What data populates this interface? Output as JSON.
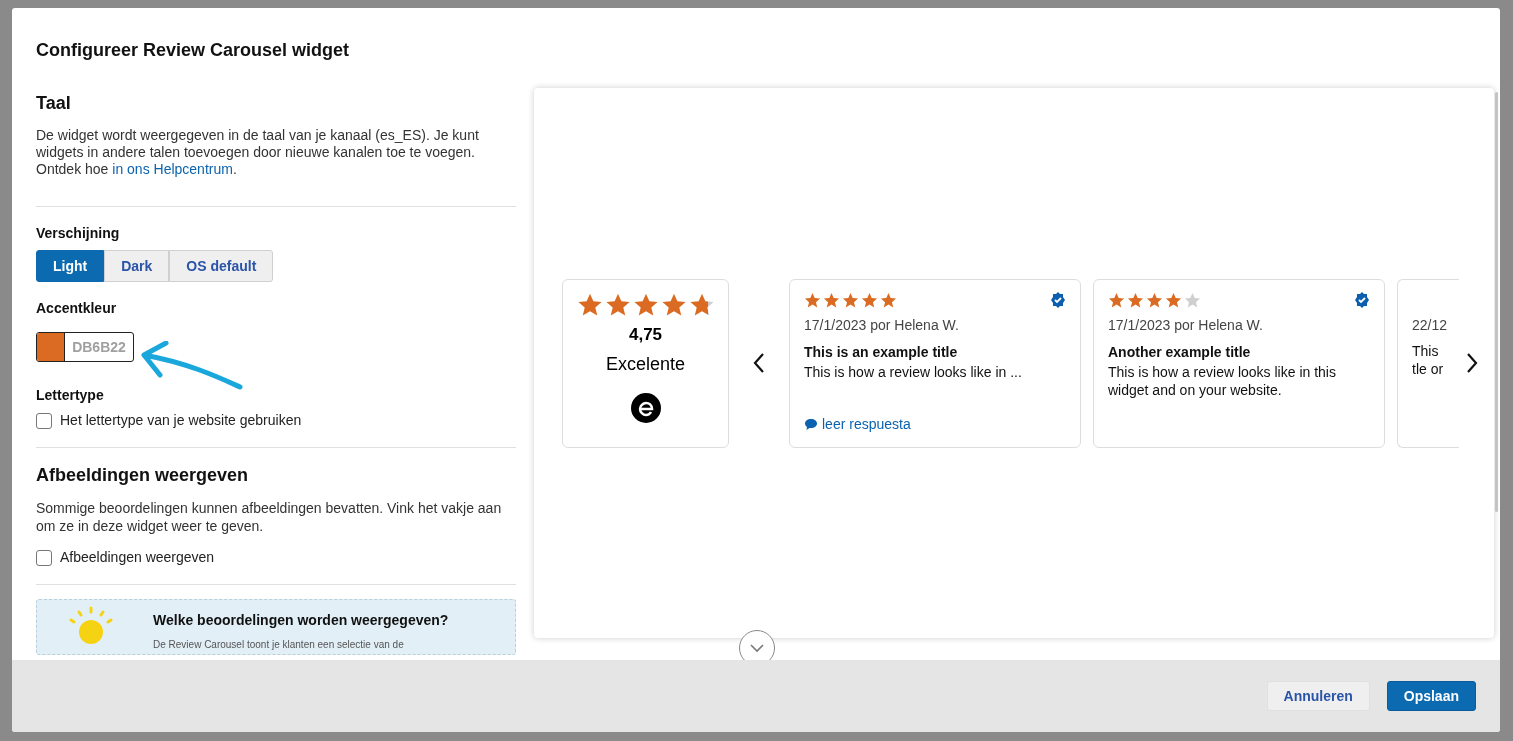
{
  "dialog": {
    "title": "Configureer Review Carousel widget"
  },
  "language": {
    "heading": "Taal",
    "text": "De widget wordt weergegeven in de taal van je kanaal (es_ES). Je kunt widgets in andere talen toevoegen door nieuwe kanalen toe te voegen. Ontdek hoe ",
    "link": "in ons Helpcentrum",
    "after": "."
  },
  "appearance": {
    "label": "Verschijning",
    "options": [
      {
        "label": "Light",
        "selected": true
      },
      {
        "label": "Dark",
        "selected": false
      },
      {
        "label": "OS default",
        "selected": false
      }
    ]
  },
  "accent": {
    "label": "Accentkleur",
    "value": "DB6B22"
  },
  "font": {
    "label": "Lettertype",
    "checkbox": {
      "label": "Het lettertype van je website gebruiken",
      "checked": false
    }
  },
  "images": {
    "heading": "Afbeeldingen weergeven",
    "text": "Sommige beoordelingen kunnen afbeeldingen bevatten. Vink het vakje aan om ze in deze widget weer te geven.",
    "checkbox": {
      "label": "Afbeeldingen weergeven",
      "checked": false
    }
  },
  "info": {
    "title": "Welke beoordelingen worden weergegeven?",
    "text": "De Review Carousel toont je klanten een selectie van de"
  },
  "preview": {
    "summary": {
      "stars": 4.75,
      "score": "4,75",
      "rating": "Excelente"
    },
    "reviews": [
      {
        "stars": 5,
        "verified": true,
        "date": "17/1/2023 por Helena W.",
        "title": "This is an example title",
        "text": "This is how a review looks like in ...",
        "reply": "leer respuesta"
      },
      {
        "stars": 4,
        "verified": true,
        "date": "17/1/2023 por Helena W.",
        "title": "Another example title",
        "text": "This is how a review looks like in this widget and on your website."
      },
      {
        "date": "22/12",
        "text": "This\ntle or"
      }
    ]
  },
  "footer": {
    "buttons": [
      {
        "label": "Annuleren",
        "kind": "secondary"
      },
      {
        "label": "Opslaan",
        "kind": "primary"
      }
    ]
  }
}
